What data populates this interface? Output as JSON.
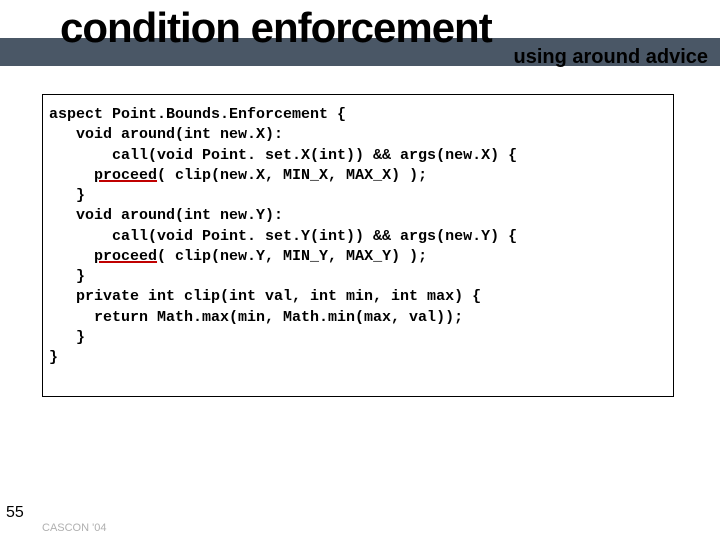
{
  "header": {
    "title": "condition enforcement",
    "subtitle": "using around advice"
  },
  "code": {
    "l1": "aspect Point.Bounds.Enforcement {",
    "l2": "",
    "l3": "   void around(int new.X):",
    "l4": "       call(void Point. set.X(int)) && args(new.X) {",
    "l5a": "     ",
    "l5b": "proceed",
    "l5c": "( clip(new.X, MIN_X, MAX_X) );",
    "l6": "   }",
    "l7": "",
    "l8": "   void around(int new.Y):",
    "l9": "       call(void Point. set.Y(int)) && args(new.Y) {",
    "l10a": "     ",
    "l10b": "proceed",
    "l10c": "( clip(new.Y, MIN_Y, MAX_Y) );",
    "l11": "   }",
    "l12": "",
    "l13": "   private int clip(int val, int min, int max) {",
    "l14": "     return Math.max(min, Math.min(max, val));",
    "l15": "   }",
    "l16": "}"
  },
  "page_number": "55",
  "footer": "CASCON '04"
}
